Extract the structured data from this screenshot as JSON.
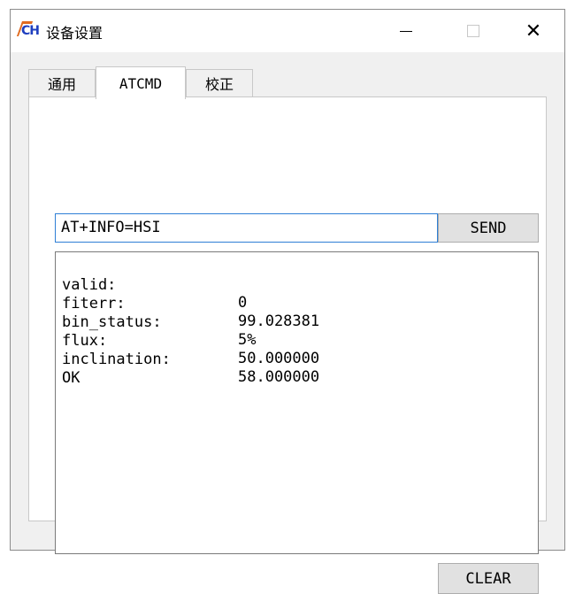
{
  "window": {
    "logo_text": "CH",
    "title": "设备设置",
    "controls": {
      "minimize": "minimize",
      "maximize": "maximize",
      "close": "close"
    }
  },
  "tabs": [
    {
      "label": "通用",
      "active": false
    },
    {
      "label": "ATCMD",
      "active": true
    },
    {
      "label": "校正",
      "active": false
    }
  ],
  "command": {
    "value": "AT+INFO=HSI",
    "send_label": "SEND"
  },
  "output": {
    "lines": [
      {
        "key": "valid:",
        "value": "0"
      },
      {
        "key": "fiterr:",
        "value": "99.028381"
      },
      {
        "key": "bin_status:",
        "value": "5%"
      },
      {
        "key": "flux:",
        "value": "50.000000"
      },
      {
        "key": "inclination:",
        "value": "58.000000"
      },
      {
        "key": "OK",
        "value": ""
      }
    ]
  },
  "clear_label": "CLEAR",
  "colors": {
    "accent": "#2e7fd6",
    "logo_blue": "#1f3fbf",
    "logo_orange": "#e06a1e"
  }
}
